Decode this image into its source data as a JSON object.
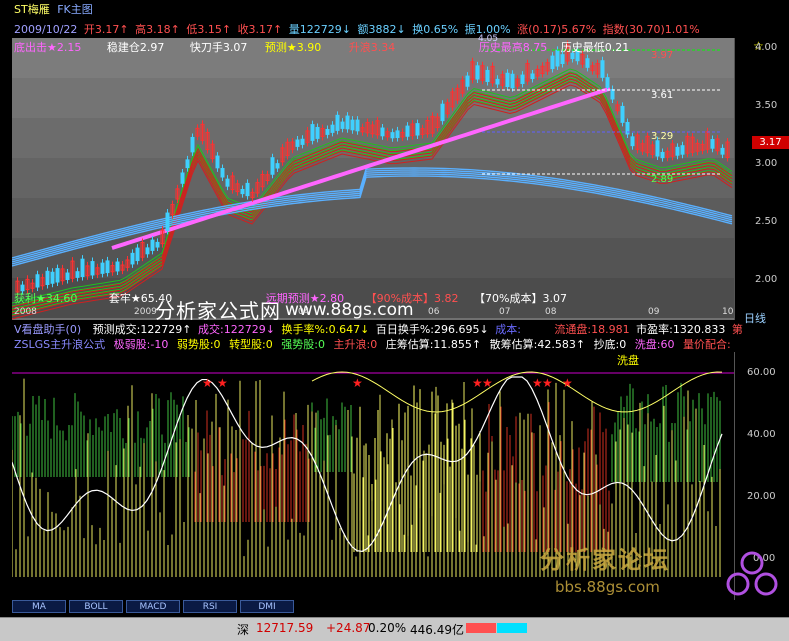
{
  "title": {
    "name": "ST梅雁",
    "chart": "FK主图"
  },
  "date": "2009/10/22",
  "quote": {
    "open": "开3.17↑",
    "high": "高3.18↑",
    "low": "低3.15↑",
    "close": "收3.17↑",
    "vol": "量122729↓",
    "amt": "额3882↓",
    "turn": "换0.65%",
    "amp": "振1.00%",
    "change": "涨(0.17)5.67%",
    "index": "指数(30.70)1.01%"
  },
  "signals": {
    "s1": "底出击★2.15",
    "s2": "稳建仓2.97",
    "s3": "快刀手3.07",
    "s4": "预测★3.90",
    "s5": "升浪3.34",
    "s6": "历史最高8.75",
    "s7": "历史最低0.21"
  },
  "bottom_labels": {
    "b1": "获利★34.60",
    "b2": "套牢★65.40",
    "b3": "远期预测★2.80",
    "b4": "【90%成本】3.82",
    "b5": "【70%成本】3.07"
  },
  "watermark": {
    "cn": "分析家公式网",
    "url": "www.88gs.com"
  },
  "watermark2": {
    "cn": "分析家论坛",
    "url": "bbs.88gs.com"
  },
  "price_axis": [
    "4.00",
    "3.50",
    "3.00",
    "2.50",
    "2.00"
  ],
  "price_tag": "3.17",
  "chart_levels": {
    "l1": "3.97",
    "l2": "3.61",
    "l3": "3.29",
    "l4": "2.89",
    "peak": "4.05"
  },
  "time_axis": [
    "2008",
    "2009",
    "04",
    "06",
    "07",
    "08",
    "09",
    "10"
  ],
  "period": "日线",
  "row2": {
    "name": "V看盘助手(0)",
    "vol": "预测成交:122729↑",
    "deal": "成交:122729↓",
    "turn": "换手率%:0.647↓",
    "hundred": "百日换手%:296.695↓",
    "cost": "成本:",
    "float": "流通盘:18.981",
    "pe": "市盈率:1320.833",
    "more": "第"
  },
  "row3": {
    "name": "ZSLGS主升浪公式",
    "weak": "极弱股:-10",
    "weaker": "弱势股:0",
    "turn": "转型股:0",
    "strong": "强势股:0",
    "main": "主升浪:0",
    "zhuang": "庄筹估算:11.855↑",
    "san": "散筹估算:42.583↑",
    "dip": "抄底:0",
    "wash": "洗盘:60",
    "vp": "量价配合:"
  },
  "wash_label": "洗盘",
  "ind_axis": [
    "60.00",
    "40.00",
    "20.00",
    "0.00"
  ],
  "tabs": [
    "MA",
    "BOLL",
    "MACD",
    "RSI",
    "DMI"
  ],
  "status": {
    "market": "深",
    "index": "12717.59",
    "diff": "+24.87",
    "pct": "0.20%",
    "amount": "446.49亿"
  }
}
